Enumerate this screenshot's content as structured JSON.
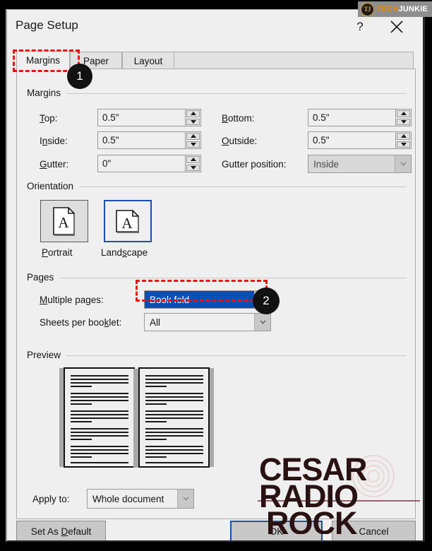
{
  "branding": {
    "logo_tech": "TECH",
    "logo_junkie": "JUNKIE",
    "logo_mark": "TJ"
  },
  "window": {
    "title": "Page Setup",
    "help_label": "?",
    "close_label": "Close"
  },
  "tabs": [
    {
      "label": "Margins",
      "active": true
    },
    {
      "label": "Paper",
      "active": false
    },
    {
      "label": "Layout",
      "active": false
    }
  ],
  "margins_group": {
    "title": "Margins",
    "fields": [
      {
        "label_pre": "T",
        "label_key": "o",
        "label_post": "p:",
        "label": "Top:",
        "value": "0.5\""
      },
      {
        "label": "Bottom:",
        "value": "0.5\""
      },
      {
        "label": "Inside:",
        "value": "0.5\""
      },
      {
        "label": "Outside:",
        "value": "0.5\""
      },
      {
        "label": "Gutter:",
        "value": "0\""
      }
    ],
    "gutter_position": {
      "label": "Gutter position:",
      "value": "Inside",
      "enabled": false
    }
  },
  "orientation_group": {
    "title": "Orientation",
    "options": [
      {
        "label": "Portrait",
        "selected": false
      },
      {
        "label": "Landscape",
        "selected": true
      }
    ]
  },
  "pages_group": {
    "title": "Pages",
    "multiple_pages": {
      "label": "Multiple pages:",
      "value": "Book fold",
      "highlighted": true
    },
    "sheets_per_booklet": {
      "label": "Sheets per booklet:",
      "value": "All"
    }
  },
  "preview_group": {
    "title": "Preview"
  },
  "apply_to": {
    "label": "Apply to:",
    "value": "Whole document"
  },
  "footer": {
    "set_as_default": "Set As Default",
    "ok": "OK",
    "cancel": "Cancel"
  },
  "annotations": {
    "badge_one": "1",
    "badge_two": "2"
  },
  "watermark": {
    "line1": "CESAR",
    "line2": "RADIO",
    "line3": "ROCK"
  },
  "colors": {
    "accent_blue": "#0a4fb4",
    "annotation_red": "#ee1111",
    "brand_orange": "#e8870c",
    "dialog_bg": "#efefef"
  }
}
